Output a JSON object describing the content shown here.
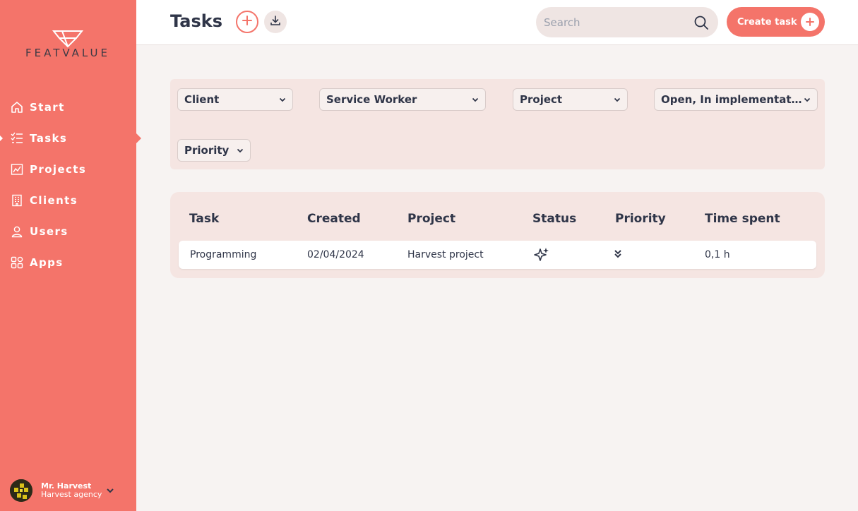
{
  "brand": {
    "name": "FEATVALUE"
  },
  "sidebar": {
    "items": [
      {
        "label": "Start",
        "icon": "home-icon"
      },
      {
        "label": "Tasks",
        "icon": "checklist-icon",
        "active": true
      },
      {
        "label": "Projects",
        "icon": "chart-icon"
      },
      {
        "label": "Clients",
        "icon": "building-icon"
      },
      {
        "label": "Users",
        "icon": "user-icon"
      },
      {
        "label": "Apps",
        "icon": "apps-grid-icon"
      }
    ],
    "user": {
      "name": "Mr. Harvest",
      "org": "Harvest agency"
    }
  },
  "header": {
    "title": "Tasks",
    "search_placeholder": "Search",
    "create_label": "Create task"
  },
  "filters": {
    "client": "Client",
    "service_worker": "Service Worker",
    "project": "Project",
    "status": "Open, In implementat...",
    "priority": "Priority"
  },
  "table": {
    "columns": [
      "Task",
      "Created",
      "Project",
      "Status",
      "Priority",
      "Time spent"
    ],
    "rows": [
      {
        "task": "Programming",
        "created": "02/04/2024",
        "project": "Harvest project",
        "status_icon": "sparkles-icon",
        "priority_icon": "double-chevron-down-icon",
        "time_spent": "0,1 h"
      }
    ]
  },
  "colors": {
    "accent": "#f4746a",
    "text": "#2f3548",
    "panel": "#f5e5e2",
    "background": "#f7f3f2"
  }
}
